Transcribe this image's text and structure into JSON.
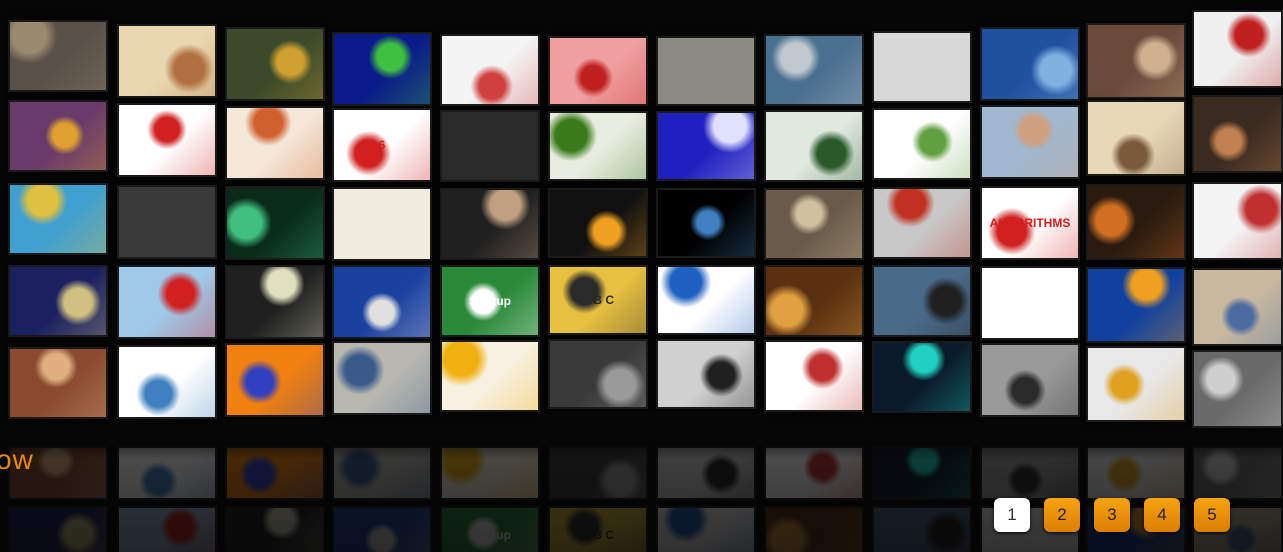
{
  "tagline": "ow",
  "pagination": {
    "pages": [
      "1",
      "2",
      "3",
      "4",
      "5"
    ],
    "active": "1"
  },
  "colors": {
    "accent": "#e88a10",
    "pager_inactive": "#f39c12",
    "pager_active": "#ffffff",
    "background": "#050505"
  },
  "rows": [
    [
      {
        "name": "building-photo-tile",
        "bg": "#5a5048",
        "fg": "#9a8a70",
        "text": ""
      },
      {
        "name": "human-evolution-tile",
        "bg": "#e9d7b0",
        "fg": "#b07040",
        "text": ""
      },
      {
        "name": "colored-blocks-tile",
        "bg": "#3a4a2a",
        "fg": "#d0a030",
        "text": ""
      },
      {
        "name": "dark-chart-tile",
        "bg": "#0a1a8a",
        "fg": "#40c040",
        "text": ""
      },
      {
        "name": "line-graph-tile",
        "bg": "#f4f4f4",
        "fg": "#d04040",
        "text": ""
      },
      {
        "name": "brain-scan-tile",
        "bg": "#f0a0a0",
        "fg": "#c02020",
        "text": ""
      },
      {
        "name": "classroom-tile",
        "bg": "#8a8a80",
        "fg": "#555",
        "text": ""
      },
      {
        "name": "landscape-tile",
        "bg": "#4a7090",
        "fg": "#c0c8d0",
        "text": ""
      },
      {
        "name": "molecule-pyramid-tile",
        "bg": "#d8d8d8",
        "fg": "#555",
        "text": ""
      },
      {
        "name": "blue-network-tile",
        "bg": "#2050a0",
        "fg": "#80b0e0",
        "text": ""
      },
      {
        "name": "group-photo-tile",
        "bg": "#6a4a3a",
        "fg": "#d0b090",
        "text": ""
      },
      {
        "name": "circle-diagram-tile",
        "bg": "#f0f0f0",
        "fg": "#c02020",
        "text": ""
      }
    ],
    [
      {
        "name": "mosaic-tile",
        "bg": "#6a3a6a",
        "fg": "#e0a030",
        "text": ""
      },
      {
        "name": "optics-diagram-tile",
        "bg": "#ffffff",
        "fg": "#d02020",
        "text": ""
      },
      {
        "name": "lab-diagram-tile",
        "bg": "#f4e8d8",
        "fg": "#d06030",
        "text": ""
      },
      {
        "name": "rubiks-cube-tile",
        "bg": "#ffffff",
        "fg": "#d02020",
        "text": "6"
      },
      {
        "name": "molecules-tile",
        "bg": "#2a2a2a",
        "fg": "#bbb",
        "text": ""
      },
      {
        "name": "green-object-tile",
        "bg": "#e8ece0",
        "fg": "#3a7a1a",
        "text": ""
      },
      {
        "name": "blue-particles-tile",
        "bg": "#2020c0",
        "fg": "#e0e0ff",
        "text": ""
      },
      {
        "name": "circuit-board-tile",
        "bg": "#e0e8e0",
        "fg": "#2a5a2a",
        "text": ""
      },
      {
        "name": "slide-no-tile",
        "bg": "#ffffff",
        "fg": "#60a040",
        "text": ""
      },
      {
        "name": "student-laptop-tile",
        "bg": "#a0b8d0",
        "fg": "#d0a080",
        "text": ""
      },
      {
        "name": "cycle-diagram-tile",
        "bg": "#e8d8b8",
        "fg": "#7a5a3a",
        "text": ""
      },
      {
        "name": "professor-tile",
        "bg": "#3a2a20",
        "fg": "#c08050",
        "text": ""
      }
    ],
    [
      {
        "name": "puzzle-hand-tile",
        "bg": "#40a0d0",
        "fg": "#e0c040",
        "text": ""
      },
      {
        "name": "chalkboard-tile",
        "bg": "#3a3a3a",
        "fg": "#ddd",
        "text": ""
      },
      {
        "name": "field-lines-tile",
        "bg": "#0a2a1a",
        "fg": "#40c080",
        "text": ""
      },
      {
        "name": "sketch-tile",
        "bg": "#f0ece0",
        "fg": "#888",
        "text": ""
      },
      {
        "name": "astronaut-tile",
        "bg": "#202020",
        "fg": "#c0a080",
        "text": ""
      },
      {
        "name": "rocket-launch-tile",
        "bg": "#101010",
        "fg": "#f0a020",
        "text": ""
      },
      {
        "name": "universe-tile",
        "bg": "#000000",
        "fg": "#4080c0",
        "text": ""
      },
      {
        "name": "painting-tile",
        "bg": "#6a5a4a",
        "fg": "#d0c0a0",
        "text": ""
      },
      {
        "name": "robot-tile",
        "bg": "#c8c8c8",
        "fg": "#c03020",
        "text": ""
      },
      {
        "name": "algorithms-tile",
        "bg": "#ffffff",
        "fg": "#d02020",
        "text": "ALGORITHMS"
      },
      {
        "name": "dance-tile",
        "bg": "#2a1a10",
        "fg": "#d07020",
        "text": ""
      },
      {
        "name": "us-map-tile",
        "bg": "#f4f4f4",
        "fg": "#c03030",
        "text": ""
      }
    ],
    [
      {
        "name": "planet-model-tile",
        "bg": "#1a2060",
        "fg": "#d0c080",
        "text": ""
      },
      {
        "name": "color-squares-tile",
        "bg": "#a0c8e8",
        "fg": "#d02020",
        "text": ""
      },
      {
        "name": "helicopter-tile",
        "bg": "#202020",
        "fg": "#e0e0c0",
        "text": ""
      },
      {
        "name": "blue-gadget-tile",
        "bg": "#1a40a0",
        "fg": "#e0e0e0",
        "text": ""
      },
      {
        "name": "startup-sign-tile",
        "bg": "#2a8a3a",
        "fg": "#ffffff",
        "text": "Startup"
      },
      {
        "name": "abc-chess-tile",
        "bg": "#e8c040",
        "fg": "#2a2a2a",
        "text": "A B C"
      },
      {
        "name": "bell-curve-tile",
        "bg": "#ffffff",
        "fg": "#2060c0",
        "text": ""
      },
      {
        "name": "crowd-tile",
        "bg": "#5a3010",
        "fg": "#e0a040",
        "text": ""
      },
      {
        "name": "camera-crew-tile",
        "bg": "#4a6a8a",
        "fg": "#202020",
        "text": ""
      },
      {
        "name": "comic-tile",
        "bg": "#ffffff",
        "fg": "#333",
        "text": ""
      },
      {
        "name": "blue-screen-tile",
        "bg": "#1040a0",
        "fg": "#f0a020",
        "text": ""
      },
      {
        "name": "family-tile",
        "bg": "#c8b8a0",
        "fg": "#4a6aa0",
        "text": ""
      }
    ],
    [
      {
        "name": "kids-tile",
        "bg": "#8a4a30",
        "fg": "#e0b080",
        "text": ""
      },
      {
        "name": "wave-diagram-tile",
        "bg": "#ffffff",
        "fg": "#4080c0",
        "text": ""
      },
      {
        "name": "flowchart-tile",
        "bg": "#f08010",
        "fg": "#3040c0",
        "text": ""
      },
      {
        "name": "lab-man-tile",
        "bg": "#b8b8b0",
        "fg": "#3a5a8a",
        "text": ""
      },
      {
        "name": "sun-diagram-tile",
        "bg": "#f8f0e0",
        "fg": "#f0b010",
        "text": ""
      },
      {
        "name": "old-machine-tile",
        "bg": "#3a3a3a",
        "fg": "#9a9a9a",
        "text": ""
      },
      {
        "name": "laptop-tile",
        "bg": "#d0d0d0",
        "fg": "#202020",
        "text": ""
      },
      {
        "name": "scatter-plot-tile",
        "bg": "#ffffff",
        "fg": "#c03030",
        "text": ""
      },
      {
        "name": "oscilloscope-tile",
        "bg": "#0a1a2a",
        "fg": "#20d0c0",
        "text": ""
      },
      {
        "name": "vintage-photo-tile",
        "bg": "#9a9a9a",
        "fg": "#2a2a2a",
        "text": ""
      },
      {
        "name": "dna-helix-tile",
        "bg": "#e8e8e8",
        "fg": "#e0a020",
        "text": ""
      },
      {
        "name": "bw-photo-tile",
        "bg": "#6a6a6a",
        "fg": "#cfcfcf",
        "text": ""
      }
    ]
  ]
}
